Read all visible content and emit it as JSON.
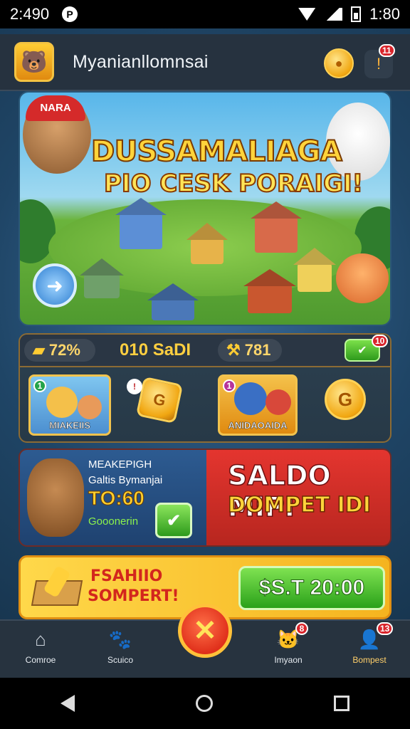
{
  "status_bar": {
    "time": "2:490",
    "clock_right": "1:80"
  },
  "header": {
    "app_title": "Myanianllomnsai",
    "bell_badge": "11"
  },
  "hero": {
    "title": "DUSSAMALIAGA",
    "subtitle": "PIO CESK PORAIGI!",
    "cap_text": "NARA"
  },
  "stats": {
    "coin_value": "72%",
    "gold_label": "010 SaDI",
    "second_value": "781",
    "green_badge": "10",
    "card_left_label": "MIAKEIIS",
    "card_left_badge": "1",
    "card_right_label": "ANIDAOAIDA",
    "card_right_badge": "1"
  },
  "wallet": {
    "line1": "MEAKEPIGH",
    "line2": "Galtis Bymanjai",
    "amount": "TO:60",
    "green_text": "Gooonerin",
    "title": "SALDO MIPI",
    "subtitle": "DOMPET IDI"
  },
  "topup": {
    "line1": "FSAHIIO",
    "line2": "SOMPERT!",
    "button_label": "$S.T 20:00"
  },
  "bottom_nav": {
    "items": [
      {
        "label": "Comroe",
        "icon": "home-icon"
      },
      {
        "label": "Scuico",
        "icon": "pet-icon"
      },
      {
        "label": "Imyaon",
        "icon": "cat-icon",
        "badge": "8"
      },
      {
        "label": "Bompest",
        "icon": "profile-icon",
        "badge": "13"
      }
    ]
  }
}
